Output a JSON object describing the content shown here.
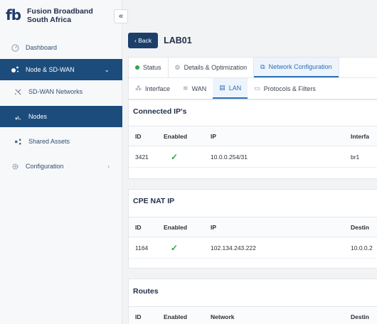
{
  "brand": {
    "name_line1": "Fusion Broadband",
    "name_line2": "South Africa",
    "logo": "fb"
  },
  "sidebar": {
    "collapse_icon": "«",
    "items": [
      {
        "label": "Dashboard",
        "icon": "dashboard-icon"
      },
      {
        "label": "Node & SD-WAN",
        "icon": "network-icon",
        "chevron": "⌄"
      },
      {
        "label": "SD-WAN Networks",
        "icon": "sdwan-icon"
      },
      {
        "label": "Nodes",
        "icon": "nodes-icon"
      },
      {
        "label": "Shared Assets",
        "icon": "share-icon"
      },
      {
        "label": "Configuration",
        "icon": "gear-icon",
        "chevron": "›"
      }
    ]
  },
  "header": {
    "back_label": "Back",
    "title": "LAB01"
  },
  "tabs_primary": [
    {
      "label": "Status"
    },
    {
      "label": "Details & Optimization"
    },
    {
      "label": "Network Configuration"
    }
  ],
  "tabs_secondary": [
    {
      "label": "Interface"
    },
    {
      "label": "WAN"
    },
    {
      "label": "LAN"
    },
    {
      "label": "Protocols & Filters"
    }
  ],
  "sections": {
    "connected": {
      "title": "Connected IP's",
      "headers": [
        "ID",
        "Enabled",
        "IP",
        "Interfa"
      ],
      "rows": [
        {
          "id": "3421",
          "ip": "10.0.0.254/31",
          "extra": "br1"
        }
      ]
    },
    "nat": {
      "title": "CPE NAT IP",
      "headers": [
        "ID",
        "Enabled",
        "IP",
        "Destin"
      ],
      "rows": [
        {
          "id": "1164",
          "ip": "102.134.243.222",
          "extra": "10.0.0.2"
        }
      ]
    },
    "routes": {
      "title": "Routes",
      "headers": [
        "ID",
        "Enabled",
        "Network",
        "Destin"
      ]
    }
  },
  "colors": {
    "accent": "#1c4c7c",
    "active_tab": "#2a6fb8",
    "enabled_check": "#2aa84a"
  }
}
